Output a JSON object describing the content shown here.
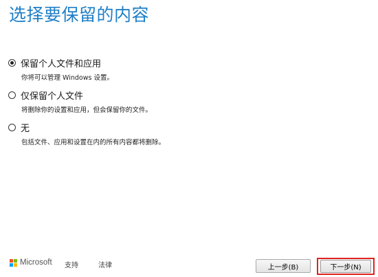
{
  "page": {
    "title": "选择要保留的内容"
  },
  "options": [
    {
      "label": "保留个人文件和应用",
      "description": "你将可以管理 Windows 设置。",
      "selected": true
    },
    {
      "label": "仅保留个人文件",
      "description": "将删除你的设置和应用，但会保留你的文件。",
      "selected": false
    },
    {
      "label": "无",
      "description": "包括文件、应用和设置在内的所有内容都将删除。",
      "selected": false
    }
  ],
  "footer": {
    "brand": "Microsoft",
    "support_label": "支持",
    "legal_label": "法律"
  },
  "buttons": {
    "back_label": "上一步(B)",
    "next_label": "下一步(N)"
  },
  "colors": {
    "title": "#1f7fc7",
    "highlight_border": "#e02020",
    "ms_red": "#f25022",
    "ms_green": "#7fba00",
    "ms_blue": "#00a4ef",
    "ms_yellow": "#ffb900"
  }
}
